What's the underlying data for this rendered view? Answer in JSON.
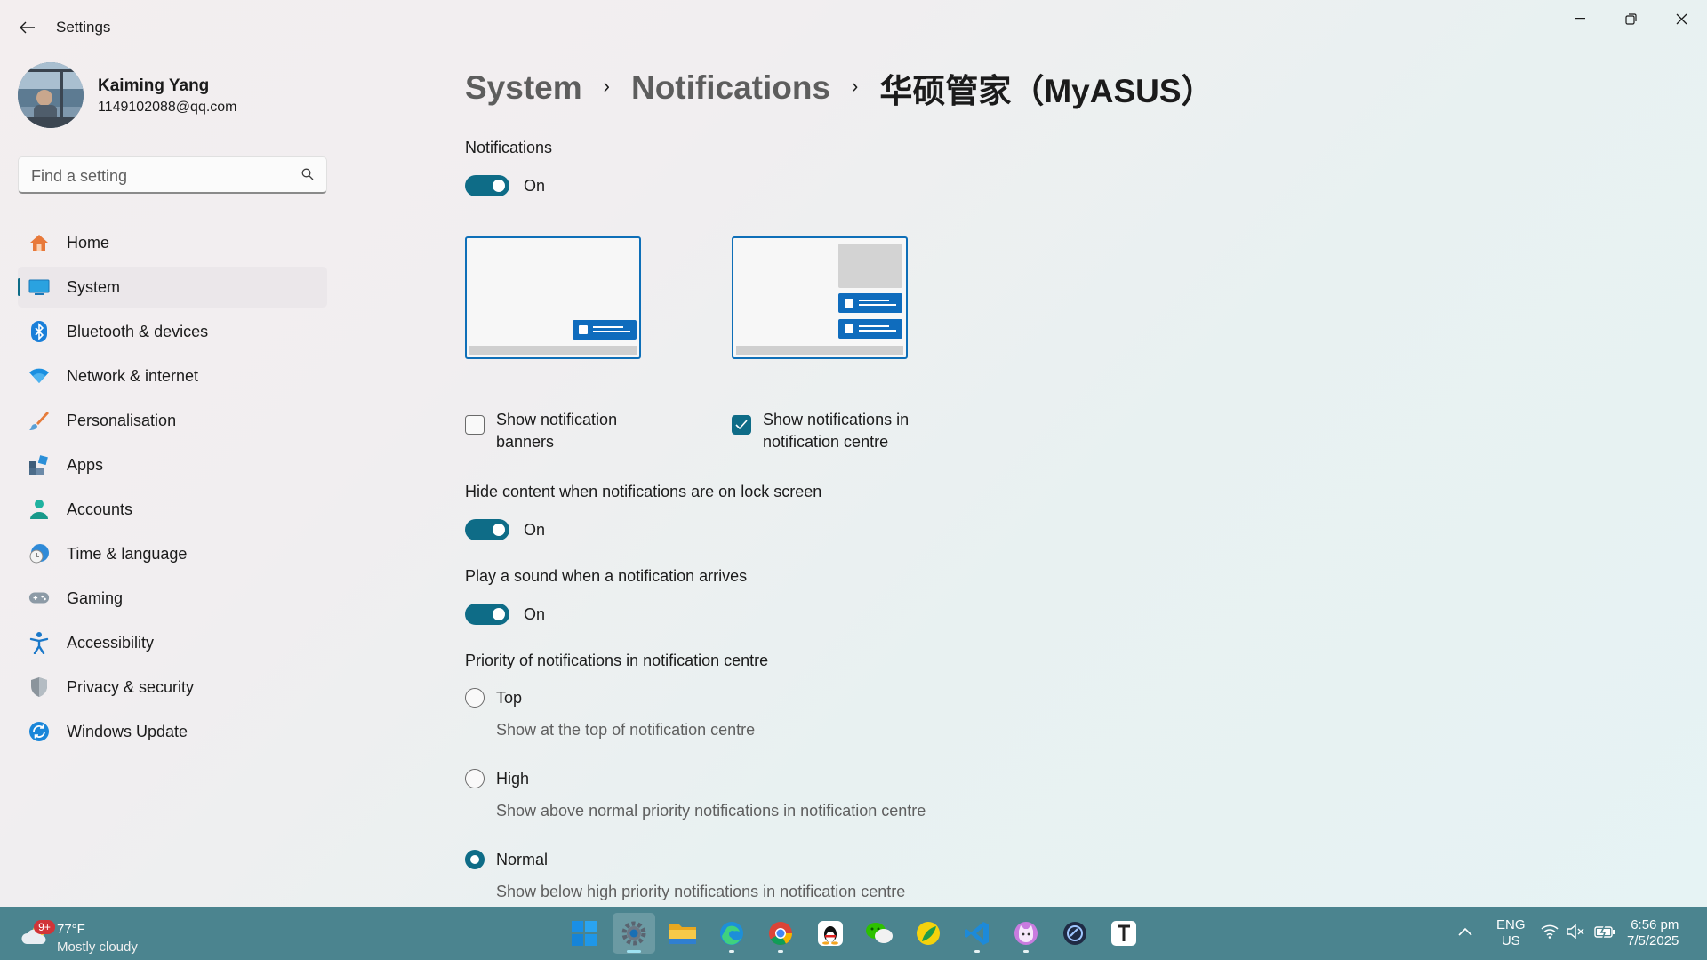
{
  "window": {
    "title": "Settings",
    "controls": {
      "minimize": "minimize",
      "maximize": "restore",
      "close": "close"
    }
  },
  "profile": {
    "name": "Kaiming Yang",
    "email": "1149102088@qq.com"
  },
  "search": {
    "placeholder": "Find a setting",
    "value": ""
  },
  "sidebar": {
    "items": [
      {
        "label": "Home",
        "icon": "home-icon",
        "active": false
      },
      {
        "label": "System",
        "icon": "system-icon",
        "active": true
      },
      {
        "label": "Bluetooth & devices",
        "icon": "bluetooth-icon",
        "active": false
      },
      {
        "label": "Network & internet",
        "icon": "wifi-icon",
        "active": false
      },
      {
        "label": "Personalisation",
        "icon": "brush-icon",
        "active": false
      },
      {
        "label": "Apps",
        "icon": "apps-icon",
        "active": false
      },
      {
        "label": "Accounts",
        "icon": "person-icon",
        "active": false
      },
      {
        "label": "Time & language",
        "icon": "globe-clock-icon",
        "active": false
      },
      {
        "label": "Gaming",
        "icon": "gamepad-icon",
        "active": false
      },
      {
        "label": "Accessibility",
        "icon": "accessibility-icon",
        "active": false
      },
      {
        "label": "Privacy & security",
        "icon": "shield-icon",
        "active": false
      },
      {
        "label": "Windows Update",
        "icon": "update-icon",
        "active": false
      }
    ]
  },
  "breadcrumb": {
    "items": [
      "System",
      "Notifications"
    ],
    "current": "华硕管家（MyASUS）",
    "separator": "›"
  },
  "settings": {
    "notifications": {
      "label": "Notifications",
      "toggle": "On",
      "on": true
    },
    "banners": {
      "label": "Show notification banners",
      "checked": false
    },
    "centre": {
      "label": "Show notifications in notification centre",
      "checked": true
    },
    "hide_content": {
      "label": "Hide content when notifications are on lock screen",
      "toggle": "On",
      "on": true
    },
    "sound": {
      "label": "Play a sound when a notification arrives",
      "toggle": "On",
      "on": true
    },
    "priority": {
      "label": "Priority of notifications in notification centre",
      "options": [
        {
          "title": "Top",
          "desc": "Show at the top of notification centre",
          "selected": false
        },
        {
          "title": "High",
          "desc": "Show above normal priority notifications in notification centre",
          "selected": false
        },
        {
          "title": "Normal",
          "desc": "Show below high priority notifications in notification centre",
          "selected": true
        }
      ]
    }
  },
  "taskbar": {
    "weather": {
      "temp": "77°F",
      "desc": "Mostly cloudy",
      "badge": "9+"
    },
    "apps": [
      {
        "name": "start-button",
        "icon": "windows-logo-icon"
      },
      {
        "name": "settings-app",
        "icon": "gear-icon",
        "active": true
      },
      {
        "name": "file-explorer-app",
        "icon": "folder-icon"
      },
      {
        "name": "edge-app",
        "icon": "edge-icon"
      },
      {
        "name": "chrome-app",
        "icon": "chrome-icon"
      },
      {
        "name": "qq-app",
        "icon": "penguin-icon"
      },
      {
        "name": "wechat-app",
        "icon": "wechat-icon"
      },
      {
        "name": "app-yellow-green",
        "icon": "leaf-icon"
      },
      {
        "name": "vscode-app",
        "icon": "vscode-icon"
      },
      {
        "name": "cat-app",
        "icon": "cat-icon"
      },
      {
        "name": "dark-app",
        "icon": "circle-app-icon"
      },
      {
        "name": "typora-app",
        "icon": "t-icon"
      }
    ],
    "lang": {
      "line1": "ENG",
      "line2": "US"
    },
    "clock": {
      "time": "6:56 pm",
      "date": "7/5/2025"
    }
  },
  "colors": {
    "accent": "#0e6c87",
    "preview_blue": "#0f6cbd",
    "taskbar": "#4b848f"
  }
}
